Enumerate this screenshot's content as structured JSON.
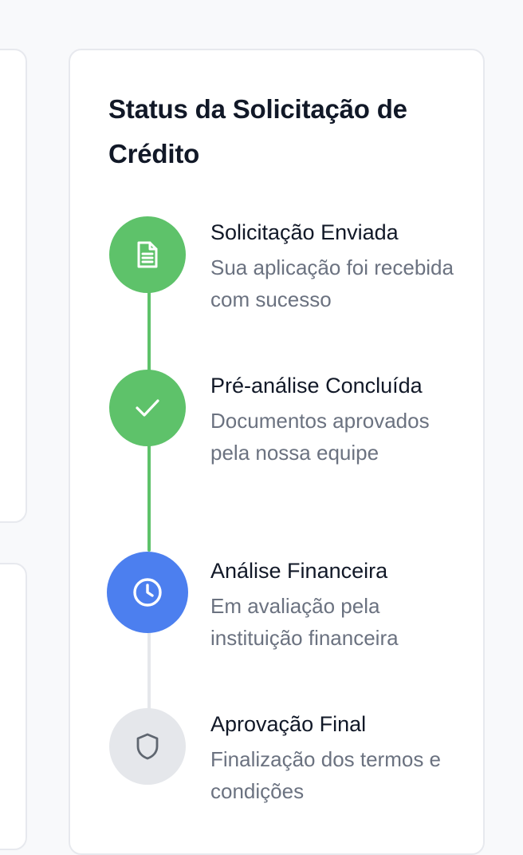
{
  "card": {
    "title": "Status da Solicitação de Crédito"
  },
  "steps": [
    {
      "title": "Solicitação Enviada",
      "description": "Sua aplicação foi recebida com sucesso",
      "state": "completed",
      "icon": "document-icon"
    },
    {
      "title": "Pré-análise Concluída",
      "description": "Documentos aprovados pela nossa equipe",
      "state": "completed",
      "icon": "check-icon"
    },
    {
      "title": "Análise Financeira",
      "description": "Em avaliação pela instituição financeira",
      "state": "current",
      "icon": "clock-icon"
    },
    {
      "title": "Aprovação Final",
      "description": "Finalização dos termos e condições",
      "state": "pending",
      "icon": "shield-icon"
    }
  ],
  "colors": {
    "completed": "#5ec26a",
    "current": "#4c7fef",
    "pending": "#e5e7eb",
    "title_text": "#111827",
    "muted_text": "#6b7280"
  }
}
